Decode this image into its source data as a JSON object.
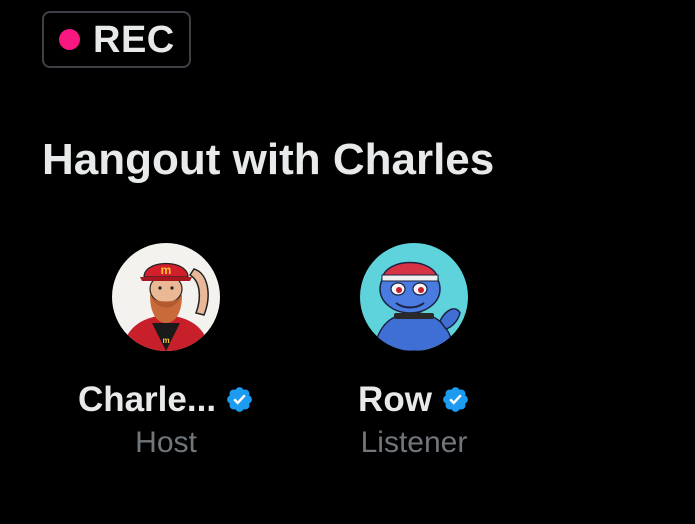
{
  "recording": {
    "label": "REC",
    "dot_color": "#f91880"
  },
  "space": {
    "title": "Hangout with Charles"
  },
  "participants": [
    {
      "name": "Charle...",
      "role": "Host",
      "verified": true,
      "avatar_icon": "avatar-red-cap-bearded-man",
      "badge_icon": "verified-badge-icon"
    },
    {
      "name": "Row",
      "role": "Listener",
      "verified": true,
      "avatar_icon": "avatar-blue-creature-red-hat",
      "badge_icon": "verified-badge-icon"
    }
  ],
  "colors": {
    "background": "#000000",
    "primary_text": "#e7e9ea",
    "secondary_text": "#71767b",
    "verified_blue": "#1d9bf0",
    "badge_border": "#3d4145"
  }
}
